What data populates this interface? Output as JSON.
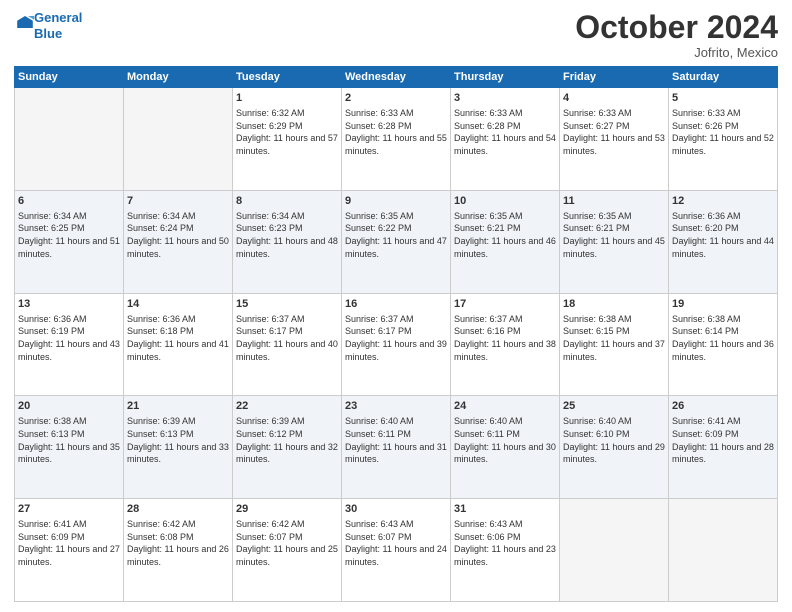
{
  "header": {
    "logo_line1": "General",
    "logo_line2": "Blue",
    "month": "October 2024",
    "location": "Jofrito, Mexico"
  },
  "weekdays": [
    "Sunday",
    "Monday",
    "Tuesday",
    "Wednesday",
    "Thursday",
    "Friday",
    "Saturday"
  ],
  "weeks": [
    [
      {
        "day": "",
        "sunrise": "",
        "sunset": "",
        "daylight": ""
      },
      {
        "day": "",
        "sunrise": "",
        "sunset": "",
        "daylight": ""
      },
      {
        "day": "1",
        "sunrise": "Sunrise: 6:32 AM",
        "sunset": "Sunset: 6:29 PM",
        "daylight": "Daylight: 11 hours and 57 minutes."
      },
      {
        "day": "2",
        "sunrise": "Sunrise: 6:33 AM",
        "sunset": "Sunset: 6:28 PM",
        "daylight": "Daylight: 11 hours and 55 minutes."
      },
      {
        "day": "3",
        "sunrise": "Sunrise: 6:33 AM",
        "sunset": "Sunset: 6:28 PM",
        "daylight": "Daylight: 11 hours and 54 minutes."
      },
      {
        "day": "4",
        "sunrise": "Sunrise: 6:33 AM",
        "sunset": "Sunset: 6:27 PM",
        "daylight": "Daylight: 11 hours and 53 minutes."
      },
      {
        "day": "5",
        "sunrise": "Sunrise: 6:33 AM",
        "sunset": "Sunset: 6:26 PM",
        "daylight": "Daylight: 11 hours and 52 minutes."
      }
    ],
    [
      {
        "day": "6",
        "sunrise": "Sunrise: 6:34 AM",
        "sunset": "Sunset: 6:25 PM",
        "daylight": "Daylight: 11 hours and 51 minutes."
      },
      {
        "day": "7",
        "sunrise": "Sunrise: 6:34 AM",
        "sunset": "Sunset: 6:24 PM",
        "daylight": "Daylight: 11 hours and 50 minutes."
      },
      {
        "day": "8",
        "sunrise": "Sunrise: 6:34 AM",
        "sunset": "Sunset: 6:23 PM",
        "daylight": "Daylight: 11 hours and 48 minutes."
      },
      {
        "day": "9",
        "sunrise": "Sunrise: 6:35 AM",
        "sunset": "Sunset: 6:22 PM",
        "daylight": "Daylight: 11 hours and 47 minutes."
      },
      {
        "day": "10",
        "sunrise": "Sunrise: 6:35 AM",
        "sunset": "Sunset: 6:21 PM",
        "daylight": "Daylight: 11 hours and 46 minutes."
      },
      {
        "day": "11",
        "sunrise": "Sunrise: 6:35 AM",
        "sunset": "Sunset: 6:21 PM",
        "daylight": "Daylight: 11 hours and 45 minutes."
      },
      {
        "day": "12",
        "sunrise": "Sunrise: 6:36 AM",
        "sunset": "Sunset: 6:20 PM",
        "daylight": "Daylight: 11 hours and 44 minutes."
      }
    ],
    [
      {
        "day": "13",
        "sunrise": "Sunrise: 6:36 AM",
        "sunset": "Sunset: 6:19 PM",
        "daylight": "Daylight: 11 hours and 43 minutes."
      },
      {
        "day": "14",
        "sunrise": "Sunrise: 6:36 AM",
        "sunset": "Sunset: 6:18 PM",
        "daylight": "Daylight: 11 hours and 41 minutes."
      },
      {
        "day": "15",
        "sunrise": "Sunrise: 6:37 AM",
        "sunset": "Sunset: 6:17 PM",
        "daylight": "Daylight: 11 hours and 40 minutes."
      },
      {
        "day": "16",
        "sunrise": "Sunrise: 6:37 AM",
        "sunset": "Sunset: 6:17 PM",
        "daylight": "Daylight: 11 hours and 39 minutes."
      },
      {
        "day": "17",
        "sunrise": "Sunrise: 6:37 AM",
        "sunset": "Sunset: 6:16 PM",
        "daylight": "Daylight: 11 hours and 38 minutes."
      },
      {
        "day": "18",
        "sunrise": "Sunrise: 6:38 AM",
        "sunset": "Sunset: 6:15 PM",
        "daylight": "Daylight: 11 hours and 37 minutes."
      },
      {
        "day": "19",
        "sunrise": "Sunrise: 6:38 AM",
        "sunset": "Sunset: 6:14 PM",
        "daylight": "Daylight: 11 hours and 36 minutes."
      }
    ],
    [
      {
        "day": "20",
        "sunrise": "Sunrise: 6:38 AM",
        "sunset": "Sunset: 6:13 PM",
        "daylight": "Daylight: 11 hours and 35 minutes."
      },
      {
        "day": "21",
        "sunrise": "Sunrise: 6:39 AM",
        "sunset": "Sunset: 6:13 PM",
        "daylight": "Daylight: 11 hours and 33 minutes."
      },
      {
        "day": "22",
        "sunrise": "Sunrise: 6:39 AM",
        "sunset": "Sunset: 6:12 PM",
        "daylight": "Daylight: 11 hours and 32 minutes."
      },
      {
        "day": "23",
        "sunrise": "Sunrise: 6:40 AM",
        "sunset": "Sunset: 6:11 PM",
        "daylight": "Daylight: 11 hours and 31 minutes."
      },
      {
        "day": "24",
        "sunrise": "Sunrise: 6:40 AM",
        "sunset": "Sunset: 6:11 PM",
        "daylight": "Daylight: 11 hours and 30 minutes."
      },
      {
        "day": "25",
        "sunrise": "Sunrise: 6:40 AM",
        "sunset": "Sunset: 6:10 PM",
        "daylight": "Daylight: 11 hours and 29 minutes."
      },
      {
        "day": "26",
        "sunrise": "Sunrise: 6:41 AM",
        "sunset": "Sunset: 6:09 PM",
        "daylight": "Daylight: 11 hours and 28 minutes."
      }
    ],
    [
      {
        "day": "27",
        "sunrise": "Sunrise: 6:41 AM",
        "sunset": "Sunset: 6:09 PM",
        "daylight": "Daylight: 11 hours and 27 minutes."
      },
      {
        "day": "28",
        "sunrise": "Sunrise: 6:42 AM",
        "sunset": "Sunset: 6:08 PM",
        "daylight": "Daylight: 11 hours and 26 minutes."
      },
      {
        "day": "29",
        "sunrise": "Sunrise: 6:42 AM",
        "sunset": "Sunset: 6:07 PM",
        "daylight": "Daylight: 11 hours and 25 minutes."
      },
      {
        "day": "30",
        "sunrise": "Sunrise: 6:43 AM",
        "sunset": "Sunset: 6:07 PM",
        "daylight": "Daylight: 11 hours and 24 minutes."
      },
      {
        "day": "31",
        "sunrise": "Sunrise: 6:43 AM",
        "sunset": "Sunset: 6:06 PM",
        "daylight": "Daylight: 11 hours and 23 minutes."
      },
      {
        "day": "",
        "sunrise": "",
        "sunset": "",
        "daylight": ""
      },
      {
        "day": "",
        "sunrise": "",
        "sunset": "",
        "daylight": ""
      }
    ]
  ]
}
